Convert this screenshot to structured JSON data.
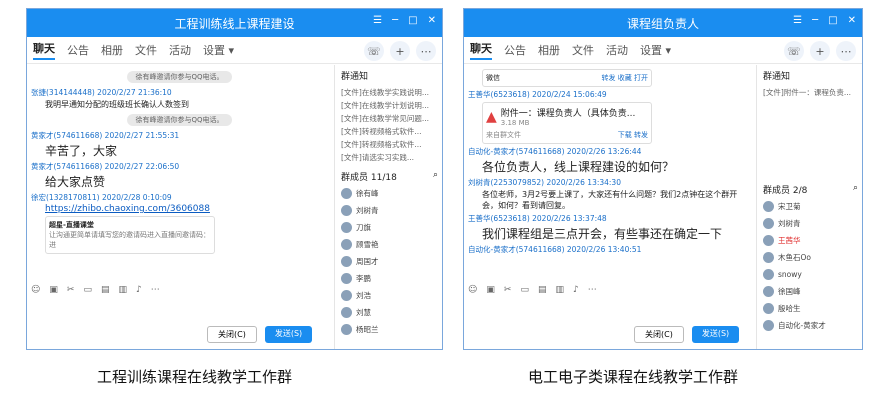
{
  "w1": {
    "title": "工程训练线上课程建设",
    "tabs": [
      "聊天",
      "公告",
      "相册",
      "文件",
      "活动",
      "设置 ▾"
    ],
    "sys1": "徐有峰邀请你参与QQ电话。",
    "m1_meta": "张捷(314144448) 2020/2/27 21:36:10",
    "m1": "我明早通知分配的班级班长确认人数签到",
    "sys2": "徐有峰邀请你参与QQ电话。",
    "m2_meta": "黄家才(574611668) 2020/2/27 21:55:31",
    "m2": "辛苦了，大家",
    "m3_meta": "黄家才(574611668) 2020/2/27 22:06:50",
    "m3": "给大家点赞",
    "m4_meta": "徐宏(1328170811) 2020/2/28 0:10:09",
    "m4_link": "https://zhibo.chaoxing.com/3606088",
    "card_title": "超星-直播课堂",
    "card_desc": "让沟通更简单请填写您的邀请码进入直播间邀请码：进",
    "notice_head": "群通知",
    "notices": [
      "[文件]在线教学实践说明...",
      "[文件]在线教学计划说明...",
      "[文件]在线教学常见问题...",
      "[文件]转视频格式软件...",
      "[文件]转视频格式软件...",
      "[文件]请选实习实践..."
    ],
    "members_head": "群成员 11/18",
    "members": [
      "徐有峰",
      "刘树青",
      "刀旗",
      "顾雪艳",
      "周国才",
      "李鹏",
      "刘浩",
      "刘慧",
      "杨昭兰"
    ],
    "btn_close": "关闭(C)",
    "btn_send": "发送(S)"
  },
  "w2": {
    "title": "课程组负责人",
    "tabs": [
      "聊天",
      "公告",
      "相册",
      "文件",
      "活动",
      "设置 ▾"
    ],
    "file0": "微信",
    "file0_actions": "转发  收藏  打开",
    "m1_meta": "王善华(6523618) 2020/2/24 15:06:49",
    "file_name": "附件一：课程负责人（具体负责...",
    "file_size": "3.18 MB",
    "file_from": "来自群文件",
    "file_actions": "下载  转发",
    "m2_meta": "自动化-黄家才(574611668) 2020/2/26 13:26:44",
    "m2": "各位负责人，线上课程建设的如何？",
    "m3_meta": "刘树青(2253079852) 2020/2/26 13:34:30",
    "m3": "各位老师，3月2号要上课了，大家还有什么问题？我们2点钟在这个群开会，如何？看到请回复。",
    "m4_meta": "王善华(6523618) 2020/2/26 13:37:48",
    "m4": "我们课程组是三点开会，有些事还在确定一下",
    "m5_meta": "自动化-黄家才(574611668) 2020/2/26 13:40:51",
    "notice_head": "群通知",
    "notices": [
      "[文件]附件一：课程负责..."
    ],
    "members_head": "群成员 2/8",
    "members": [
      "宋卫菊",
      "刘树青",
      "王茜华",
      "木鱼石Oo",
      "snowy",
      "徐国峰",
      "殷哈生",
      "自动化-黄家才"
    ],
    "btn_close": "关闭(C)",
    "btn_send": "发送(S)"
  },
  "caption_left": "工程训练课程在线教学工作群",
  "caption_right": "电工电子类课程在线教学工作群"
}
